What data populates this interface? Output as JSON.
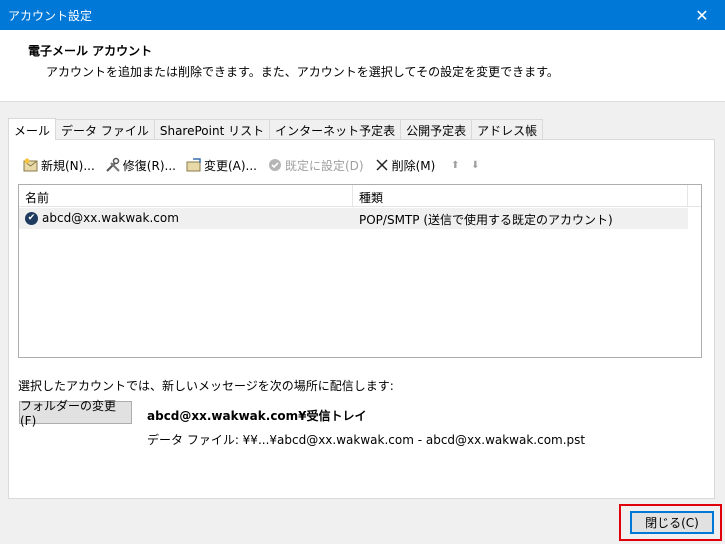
{
  "window": {
    "title": "アカウント設定",
    "close_glyph": "✕"
  },
  "header": {
    "title": "電子メール アカウント",
    "description": "アカウントを追加または削除できます。また、アカウントを選択してその設定を変更できます。"
  },
  "tabs": [
    {
      "label": "メール",
      "active": true
    },
    {
      "label": "データ ファイル"
    },
    {
      "label": "SharePoint リスト"
    },
    {
      "label": "インターネット予定表"
    },
    {
      "label": "公開予定表"
    },
    {
      "label": "アドレス帳"
    }
  ],
  "toolbar": {
    "new": "新規(N)...",
    "repair": "修復(R)...",
    "change": "変更(A)...",
    "set_default": "既定に設定(D)",
    "remove": "削除(M)",
    "up_glyph": "⬆",
    "down_glyph": "⬇"
  },
  "account_list": {
    "columns": [
      "名前",
      "種類"
    ],
    "rows": [
      {
        "name": "abcd@xx.wakwak.com",
        "type": "POP/SMTP (送信で使用する既定のアカウント)",
        "default_glyph": "✔"
      }
    ]
  },
  "delivery": {
    "label": "選択したアカウントでは、新しいメッセージを次の場所に配信します:",
    "folder_button": "フォルダーの変更(F)",
    "target": "abcd@xx.wakwak.com¥受信トレイ",
    "datafile": "データ ファイル: ¥¥...¥abcd@xx.wakwak.com - abcd@xx.wakwak.com.pst"
  },
  "footer": {
    "close_button": "閉じる(C)"
  },
  "colors": {
    "titlebar": "#0078d7",
    "highlight_box": "#e0000b"
  },
  "icons": {
    "new": "new-mail-icon",
    "repair": "repair-tools-icon",
    "change": "change-settings-icon",
    "set_default": "default-check-icon",
    "remove": "delete-x-icon"
  }
}
